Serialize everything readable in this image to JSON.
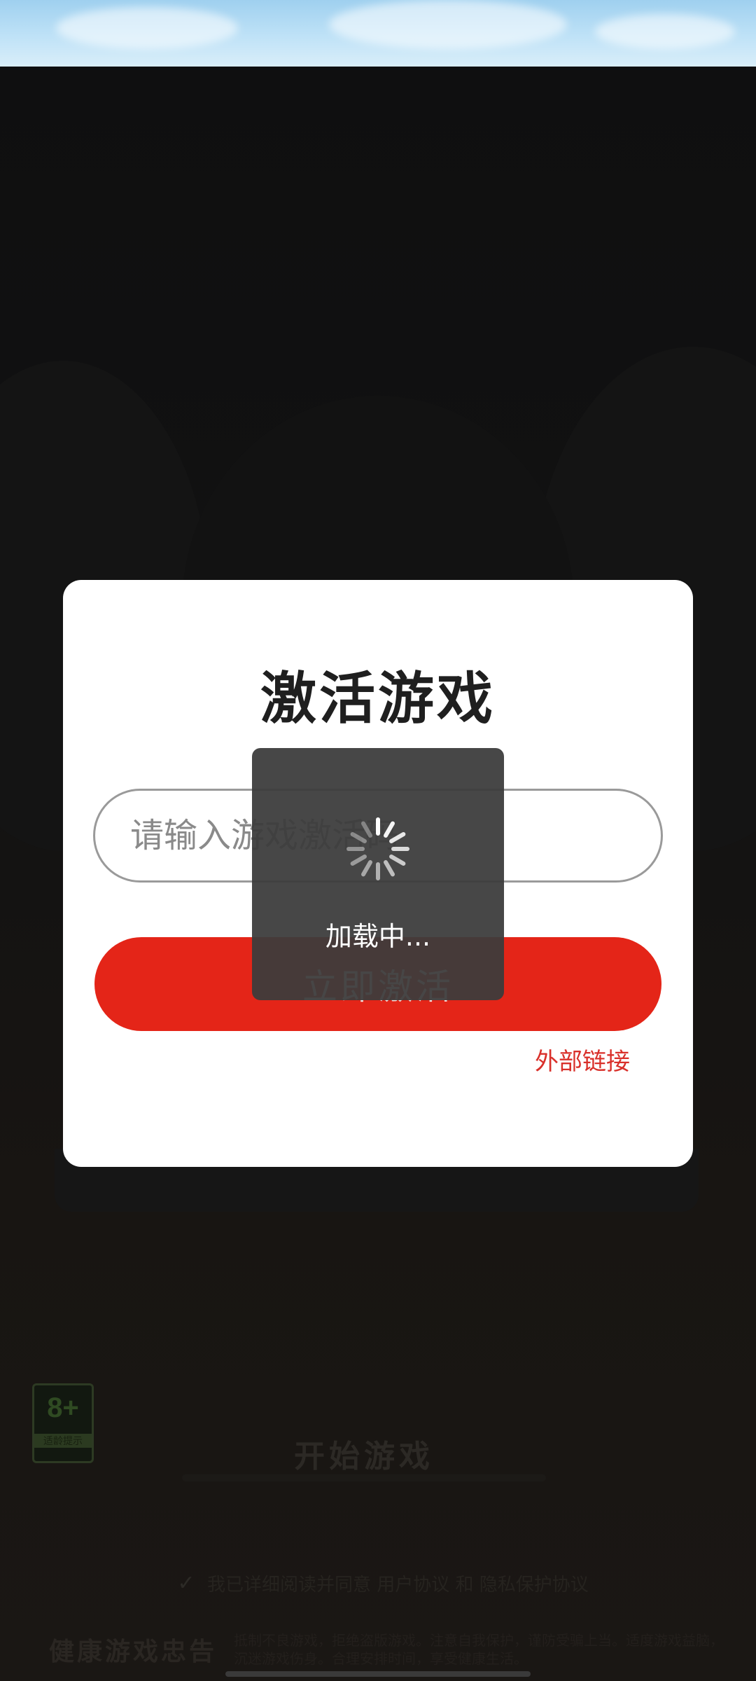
{
  "dialog": {
    "title": "激活游戏",
    "code_placeholder": "请输入游戏激活码",
    "activate_label": "立即激活",
    "external_link": "外部链接"
  },
  "loading": {
    "text": "加载中..."
  },
  "background": {
    "age_rating": "8+",
    "age_tip": "适龄提示",
    "start_label": "开始游戏",
    "agreement": "我已详细阅读并同意 用户协议 和 隐私保护协议",
    "health_title": "健康游戏忠告",
    "health_text": "抵制不良游戏，拒绝盗版游戏。注意自我保护，谨防受骗上当。适度游戏益脑，沉迷游戏伤身。合理安排时间，享受健康生活。"
  },
  "colors": {
    "accent_red": "#e42518",
    "link_red": "#d9302a",
    "dialog_bg": "#ffffff",
    "overlay_bg": "#0d0d0d"
  },
  "icons": [
    "loading-spinner-icon",
    "checkbox-check-icon"
  ]
}
